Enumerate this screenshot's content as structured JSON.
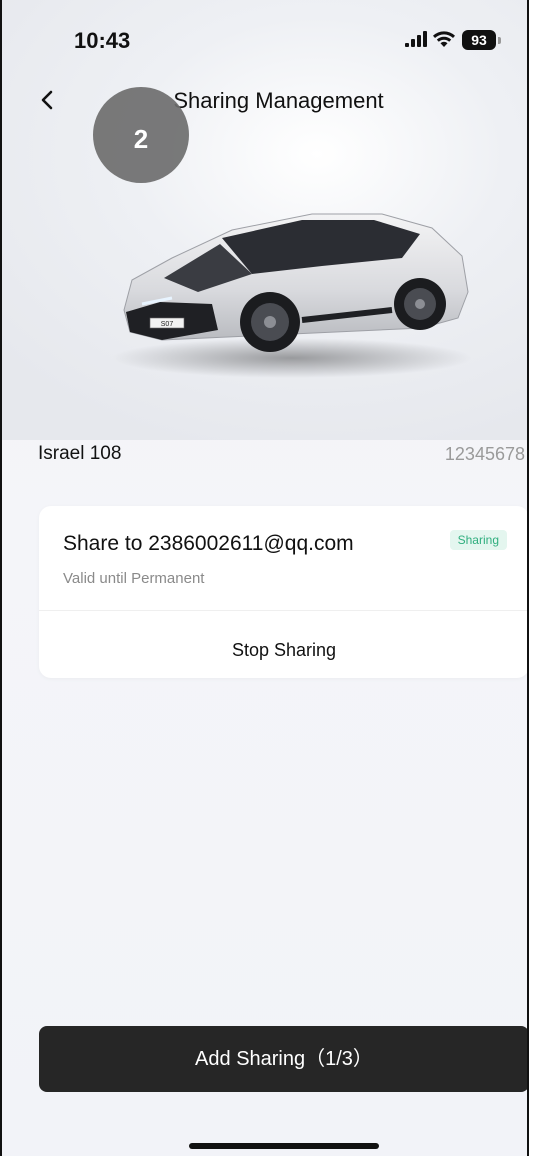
{
  "status_bar": {
    "time": "10:43",
    "battery": "93"
  },
  "header": {
    "title": "Sharing Management",
    "step_marker": "2"
  },
  "vehicle": {
    "name": "Israel 108",
    "id": "12345678",
    "plate_text": "S07"
  },
  "share_card": {
    "title": "Share to 2386002611@qq.com",
    "validity": "Valid until Permanent",
    "status": "Sharing",
    "stop_label": "Stop Sharing"
  },
  "footer": {
    "add_label": "Add Sharing（1/3）"
  },
  "icons": {
    "back": "chevron-left-icon",
    "signal": "cellular-signal-icon",
    "wifi": "wifi-icon",
    "battery": "battery-icon"
  },
  "colors": {
    "badge_bg": "#e4f6ef",
    "badge_text": "#2fae7e",
    "button_bg": "#262626"
  }
}
